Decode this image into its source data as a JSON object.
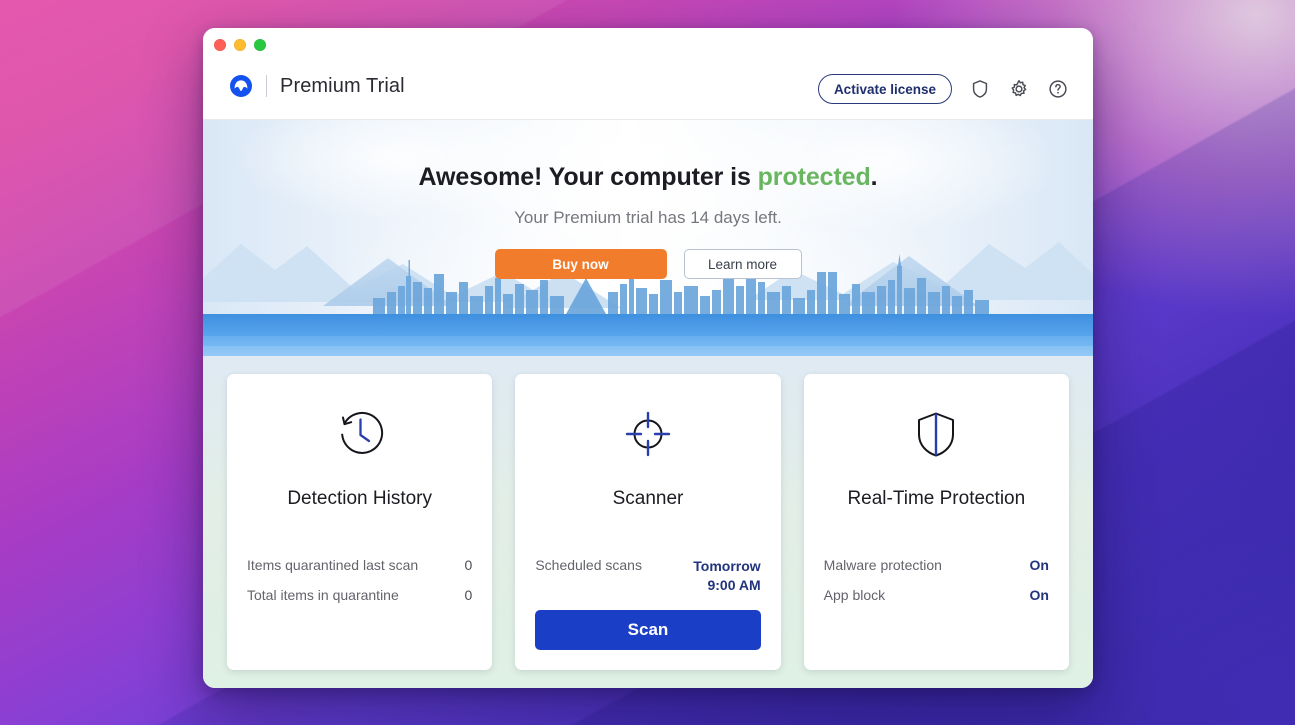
{
  "window": {
    "traffic_lights": [
      "close",
      "minimize",
      "zoom"
    ],
    "brand_title": "Premium Trial",
    "logo_icon": "malwarebytes-logo-icon"
  },
  "toolbar": {
    "activate_label": "Activate license",
    "icons": [
      {
        "name": "shield-icon",
        "label": "Protection"
      },
      {
        "name": "gear-icon",
        "label": "Settings"
      },
      {
        "name": "help-icon",
        "label": "Help"
      }
    ]
  },
  "hero": {
    "headline_prefix": "Awesome! Your computer is ",
    "headline_status": "protected",
    "headline_suffix": ".",
    "subtitle": "Your Premium trial has 14 days left.",
    "buy_label": "Buy now",
    "learn_label": "Learn more",
    "status_color": "#68b760",
    "buy_color": "#f07c2c"
  },
  "cards": [
    {
      "id": "detection-history",
      "icon": "clock-history-icon",
      "title": "Detection History",
      "rows": [
        {
          "label": "Items quarantined last scan",
          "value": "0",
          "style": "plain"
        },
        {
          "label": "Total items in quarantine",
          "value": "0",
          "style": "plain"
        }
      ],
      "action": null
    },
    {
      "id": "scanner",
      "icon": "crosshair-target-icon",
      "title": "Scanner",
      "rows": [
        {
          "label": "Scheduled scans",
          "value": "Tomorrow\n9:00 AM",
          "style": "blue"
        }
      ],
      "action": {
        "label": "Scan",
        "color": "#1b3ec7"
      }
    },
    {
      "id": "real-time-protection",
      "icon": "shield-solid-icon",
      "title": "Real-Time Protection",
      "rows": [
        {
          "label": "Malware protection",
          "value": "On",
          "style": "on"
        },
        {
          "label": "App block",
          "value": "On",
          "style": "on"
        }
      ],
      "action": null
    }
  ]
}
